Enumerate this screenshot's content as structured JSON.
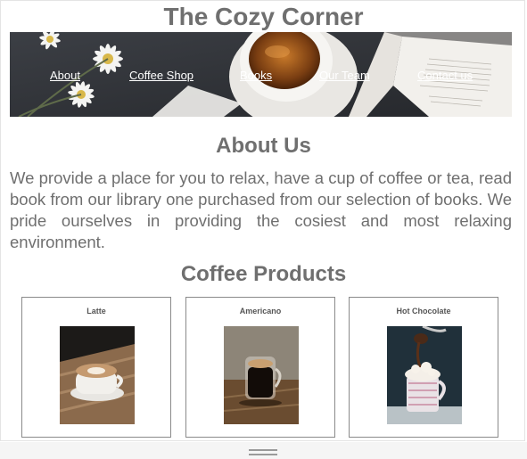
{
  "site": {
    "title": "The Cozy Corner"
  },
  "nav": {
    "items": [
      {
        "label": "About"
      },
      {
        "label": "Coffee Shop"
      },
      {
        "label": "Books"
      },
      {
        "label": "Our Team"
      },
      {
        "label": "Contact us"
      }
    ]
  },
  "about": {
    "heading": "About Us",
    "text": "We provide a place for you to relax, have a cup of coffee or tea, read book from our library one purchased from our selection of books. We pride ourselves in providing the cosiest and most relaxing environment."
  },
  "products": {
    "heading": "Coffee Products",
    "items": [
      {
        "name": "Latte",
        "icon": "latte-photo"
      },
      {
        "name": "Americano",
        "icon": "americano-photo"
      },
      {
        "name": "Hot Chocolate",
        "icon": "hot-chocolate-photo"
      }
    ]
  },
  "colors": {
    "text": "#6f6f6f",
    "link": "#ffffff",
    "card_border": "#8a8a8a"
  }
}
